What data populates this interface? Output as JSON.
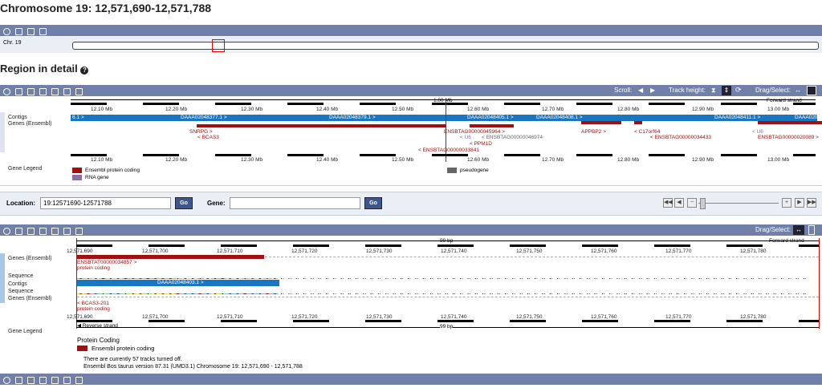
{
  "page_title": "Chromosome 19: 12,571,690-12,571,788",
  "region_title": "Region in detail",
  "chr_label": "Chr. 19",
  "toolbar1": {
    "scroll_label": "Scroll:",
    "track_height_label": "Track height:",
    "drag_select_label": "Drag/Select:"
  },
  "region_tracks": {
    "contigs_label": "Contigs",
    "genes_label": "Genes (Ensembl)",
    "gene_legend_label": "Gene Legend",
    "scale_top": "1.00 Mb",
    "forward_strand": "Forward strand",
    "ticks": [
      "12.10 Mb",
      "12.20 Mb",
      "12.30 Mb",
      "12.40 Mb",
      "12.50 Mb",
      "12.60 Mb",
      "12.70 Mb",
      "12.80 Mb",
      "12.90 Mb",
      "13.00 Mb"
    ],
    "contigs": [
      "6.1 >",
      "DAAA02048377.1 >",
      "DAAA02048379.1 >",
      "DAAA02048405.1 >",
      "DAAA02048408.1 >",
      "DAAA02048411.1 >",
      "DAAA020"
    ],
    "genes": [
      "SNRPG >",
      "< BCAS3",
      "ENSBTAG00000045964 >",
      "< U6",
      "< ENSBTAG00000046974",
      "< PPM1D",
      "< ENSBTAG00000033841",
      "APPBP2 >",
      "< C17orf64",
      "< ENSBTAG00000034433",
      "< U6",
      "ENSBTAG00000020089 >"
    ],
    "legend": {
      "protein_coding": "Ensembl protein coding",
      "rna_gene": "RNA gene",
      "pseudogene": "pseudogene"
    },
    "colors": {
      "protein_coding": "#a01010",
      "rna_gene": "#8a6fa0",
      "pseudogene": "#666666",
      "contig": "#1b76c2"
    }
  },
  "location_bar": {
    "location_label": "Location:",
    "location_value": "19:12571690-12571788",
    "go1": "Go",
    "gene_label": "Gene:",
    "gene_value": "",
    "go2": "Go"
  },
  "toolbar2": {
    "drag_select_label": "Drag/Select:"
  },
  "detail_tracks": {
    "genes_label": "Genes (Ensembl)",
    "sequence_label": "Sequence",
    "contigs_label": "Contigs",
    "sequence_label2": "Sequence",
    "genes_label2": "Genes (Ensembl)",
    "gene_legend_label": "Gene Legend",
    "span_top": "99 bp",
    "span_bottom": "99 bp",
    "forward_strand": "Forward strand",
    "reverse_strand": "Reverse strand",
    "ticks": [
      "12,571,690",
      "12,571,700",
      "12,571,710",
      "12,571,720",
      "12,571,730",
      "12,571,740",
      "12,571,750",
      "12,571,760",
      "12,571,770",
      "12,571,780"
    ],
    "transcript_top": "ENSBTAT00000034857 >",
    "transcript_top_type": "protein coding",
    "contig_label": "DAAA02048403.1 >",
    "transcript_bottom": "< BCAS3-201",
    "transcript_bottom_type": "protein coding",
    "seq_forward": "CAGTGGTCCTCCCAGGAGCTGGAGGAGNNNNNNNNNNNNNNNNNNNNNNNNNNNNNNNNNNNNNNNNNNNNNNNNNNNNNNNNNNNNNNNNNNNNNNN",
    "seq_reverse": "GTCACCAGGAGGGTCCTCGACCTCCTCNNNNNNNNNNNNNNNNNNNNNNNNNNNNNNNNNNNNNNNNNNNNNNNNNNNNNNNNNNNNNNNNNNNNNNN"
  },
  "legend2": {
    "heading": "Protein Coding",
    "item": "Ensembl protein coding"
  },
  "footer": {
    "tracks_off": "There are currently 57 tracks turned off.",
    "version": "Ensembl Bos taurus version 87.31 (UMD3.1) Chromosome 19: 12,571,690 - 12,571,788"
  }
}
